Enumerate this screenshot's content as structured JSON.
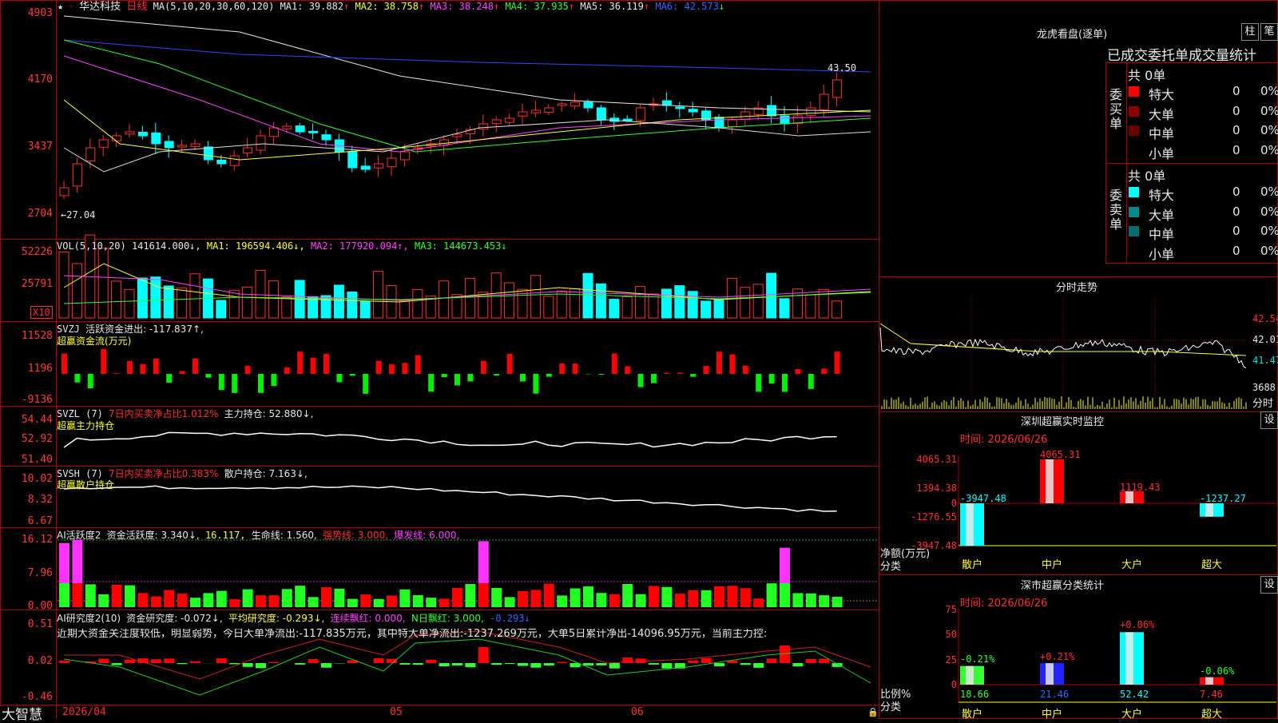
{
  "stock": {
    "name": "华达科技",
    "period": "日线",
    "favorite_icon": "star-icon"
  },
  "ma_header": {
    "prefix": "MA(5,10,20,30,60,120)",
    "items": [
      {
        "text": "MA1: 39.882",
        "arrow": "↑",
        "color": "#e8e8e8"
      },
      {
        "text": "MA2: 38.758",
        "arrow": "↑",
        "color": "#ffff33"
      },
      {
        "text": "MA3: 38.248",
        "arrow": "↑",
        "color": "#ff44ff"
      },
      {
        "text": "MA4: 37.935",
        "arrow": "↑",
        "color": "#33ff33"
      },
      {
        "text": "MA5: 36.119",
        "arrow": "↑",
        "color": "#e8e8e8"
      },
      {
        "text": "MA6: 42.573",
        "arrow": "↓",
        "color": "#3366ff"
      }
    ]
  },
  "price_axis": [
    "4903",
    "4170",
    "3437",
    "2704"
  ],
  "price_marks": {
    "high": "43.50",
    "low": "←27.04"
  },
  "vol_header": {
    "prefix": "VOL(5,10,20)",
    "v": "141614.000↓,",
    "ma1": "MA1: 196594.406↓,",
    "ma2": "MA2: 177920.094↑,",
    "ma3": "MA3: 144673.453↓"
  },
  "vol_axis": [
    "52226",
    "25791",
    "X10"
  ],
  "svzj": {
    "prefix": "SVZJ",
    "text": "活跃资金进出: -117.837↑,",
    "sub": "超赢资金流(万元)",
    "axis": [
      "11528",
      "1196",
      "-9136"
    ]
  },
  "svzl": {
    "prefix": "SVZL (7)",
    "t1": "7日内买卖净占比1.012%",
    "t2": "主力持仓: 52.880↓,",
    "sub": "超赢主力持仓",
    "axis": [
      "54.44",
      "52.92",
      "51.40"
    ]
  },
  "svsh": {
    "prefix": "SVSH (7)",
    "t1": "7日内买卖净占比0.383%",
    "t2": "散户持仓: 7.163↓,",
    "sub": "超赢散户持仓",
    "axis": [
      "10.02",
      "8.32",
      "6.67"
    ]
  },
  "ai1": {
    "prefix": "AI活跃度2",
    "t1": "资金活跃度: 3.340↓,",
    "t2": "16.117,",
    "t3": "生命线: 1.560,",
    "t4": "强势线: 3.000,",
    "t5": "爆发线: 6.000,",
    "axis": [
      "16.12",
      "7.96",
      "0.00"
    ]
  },
  "ai2": {
    "prefix": "AI研究度2(10)",
    "t1": "资金研究度: -0.072↓,",
    "t2": "平均研究度: -0.293↓,",
    "t3": "连续飘红: 0.000,",
    "t4": "N日飘红: 3.000,",
    "t5": "-0.293↓",
    "comment": "近期大资金关注度较低，明显弱势，今日大单净流出:-117.835万元，其中特大单净流出:-1237.269万元，大单5日累计净出-14096.95万元，当前主力控:",
    "axis": [
      "0.51",
      "0.02",
      "-0.46"
    ]
  },
  "footer": {
    "brand": "大智慧",
    "dates": [
      "2026/04",
      "05",
      "06"
    ]
  },
  "lhb": {
    "title": "龙虎看盘(逐单)",
    "btn1": "柱",
    "btn2": "笔",
    "section": "已成交委托单成交量统计",
    "buy_label": "委买单",
    "sell_label": "委卖单",
    "buy_total": "共 0单",
    "sell_total": "共 0单",
    "buy_rows": [
      {
        "label": "特大",
        "v": "0",
        "p": "0%",
        "color": "#ff0000"
      },
      {
        "label": "大单",
        "v": "0",
        "p": "0%",
        "color": "#8b0000"
      },
      {
        "label": "中单",
        "v": "0",
        "p": "0%",
        "color": "#6b0000"
      },
      {
        "label": "小单",
        "v": "0",
        "p": "0%",
        "color": "#000000"
      }
    ],
    "sell_rows": [
      {
        "label": "特大",
        "v": "0",
        "p": "0%",
        "color": "#00ffff"
      },
      {
        "label": "大单",
        "v": "0",
        "p": "0%",
        "color": "#008b8b"
      },
      {
        "label": "中单",
        "v": "0",
        "p": "0%",
        "color": "#007070"
      },
      {
        "label": "小单",
        "v": "0",
        "p": "0%",
        "color": "#000000"
      }
    ]
  },
  "fenshi": {
    "title": "分时走势",
    "axis": [
      "42.54",
      "42.01",
      "41.47",
      "3688"
    ],
    "axis_label": "分时"
  },
  "monitor": {
    "title": "深圳超赢实时监控",
    "set": "设",
    "time": "时间: 2026/06/26",
    "ylabels": [
      "4065.31",
      "1394.38",
      "0",
      "-1276.55",
      "-3947.48"
    ],
    "ytitle": "净额(万元)",
    "xtitle": "分类",
    "categories": [
      "散户",
      "中户",
      "大户",
      "超大"
    ],
    "values": [
      "-3947.48",
      "4065.31",
      "1119.43",
      "-1237.27"
    ]
  },
  "classify": {
    "title": "深市超赢分类统计",
    "set": "设",
    "time": "时间: 2026/06/26",
    "ylabels": [
      "75",
      "50",
      "25",
      "0"
    ],
    "ytitle": "比例%",
    "xtitle": "分类",
    "categories": [
      "散户",
      "中户",
      "大户",
      "超大"
    ],
    "values": [
      "18.66",
      "21.46",
      "52.42",
      "7.46"
    ],
    "changes": [
      "-0.21%",
      "+0.21%",
      "+0.06%",
      "-0.06%"
    ]
  },
  "chart_data": [
    {
      "type": "bar",
      "title": "深圳超赢实时监控",
      "ylabel": "净额(万元)",
      "xlabel": "分类",
      "categories": [
        "散户",
        "中户",
        "大户",
        "超大"
      ],
      "values": [
        -3947.48,
        4065.31,
        1119.43,
        -1237.27
      ],
      "ylim": [
        -3947.48,
        4065.31
      ]
    },
    {
      "type": "bar",
      "title": "深市超赢分类统计",
      "ylabel": "比例%",
      "xlabel": "分类",
      "categories": [
        "散户",
        "中户",
        "大户",
        "超大"
      ],
      "values": [
        18.66,
        21.46,
        52.42,
        7.46
      ],
      "ylim": [
        0,
        75
      ]
    }
  ]
}
